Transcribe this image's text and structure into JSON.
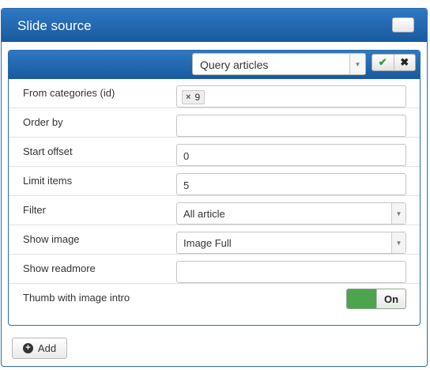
{
  "panel": {
    "title": "Slide source"
  },
  "source_select": {
    "value": "Query articles"
  },
  "actions": {
    "ok_icon": "check-icon",
    "cancel_icon": "close-icon"
  },
  "fields": {
    "from_categories": {
      "label": "From categories (id)",
      "tags": [
        "9"
      ]
    },
    "order_by": {
      "label": "Order by",
      "value": ""
    },
    "start_offset": {
      "label": "Start offset",
      "value": "0"
    },
    "limit_items": {
      "label": "Limit items",
      "value": "5"
    },
    "filter": {
      "label": "Filter",
      "value": "All article"
    },
    "show_image": {
      "label": "Show image",
      "value": "Image Full"
    },
    "show_readmore": {
      "label": "Show readmore",
      "value": ""
    },
    "thumb_intro": {
      "label": "Thumb with image intro",
      "toggle_label": "On",
      "accent": "#4ea34e"
    }
  },
  "add_button": {
    "label": "Add"
  },
  "colors": {
    "header_blue": "#185a9f",
    "toggle_green": "#4ea34e"
  }
}
